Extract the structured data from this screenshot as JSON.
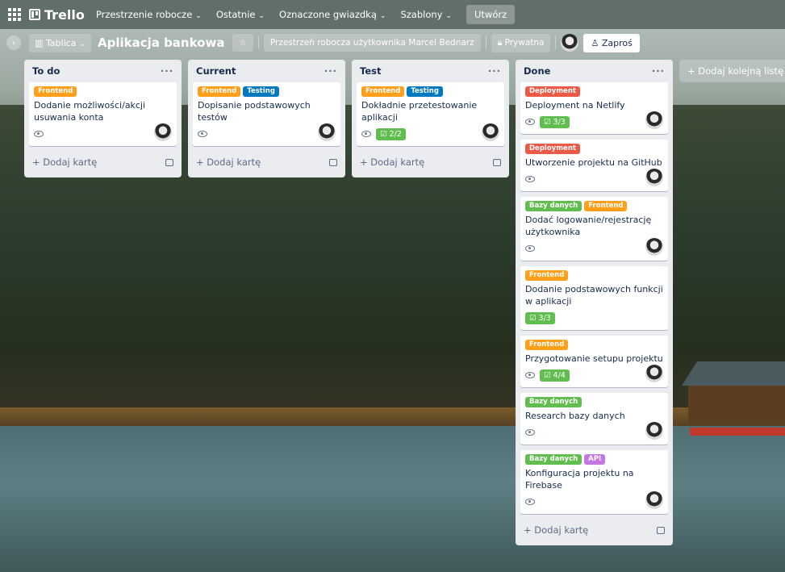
{
  "topbar": {
    "logo": "Trello",
    "nav": [
      "Przestrzenie robocze",
      "Ostatnie",
      "Oznaczone gwiazdką",
      "Szablony"
    ],
    "create": "Utwórz"
  },
  "board": {
    "view": "Tablica",
    "title": "Aplikacja bankowa",
    "star": "☆",
    "workspace": "Przestrzeń robocza użytkownika Marcel Bednarz",
    "visibility": "Prywatna",
    "invite": "Zaproś",
    "add_list": "+ Dodaj kolejną listę"
  },
  "lists": [
    {
      "title": "To do",
      "add_card": "+ Dodaj kartę",
      "cards": [
        {
          "labels": [
            {
              "text": "Frontend",
              "color": "orange"
            }
          ],
          "title": "Dodanie możliwości/akcji usuwania konta",
          "watch": true,
          "checklist": "",
          "avatar": true
        }
      ]
    },
    {
      "title": "Current",
      "add_card": "+ Dodaj kartę",
      "cards": [
        {
          "labels": [
            {
              "text": "Frontend",
              "color": "orange"
            },
            {
              "text": "Testing",
              "color": "blue"
            }
          ],
          "title": "Dopisanie podstawowych testów",
          "watch": true,
          "checklist": "",
          "avatar": true
        }
      ]
    },
    {
      "title": "Test",
      "add_card": "+ Dodaj kartę",
      "cards": [
        {
          "labels": [
            {
              "text": "Frontend",
              "color": "orange"
            },
            {
              "text": "Testing",
              "color": "blue"
            }
          ],
          "title": "Dokładnie przetestowanie aplikacji",
          "watch": true,
          "checklist": "2/2",
          "avatar": true
        }
      ]
    },
    {
      "title": "Done",
      "add_card": "+ Dodaj kartę",
      "cards": [
        {
          "labels": [
            {
              "text": "Deployment",
              "color": "red"
            }
          ],
          "title": "Deployment na Netlify",
          "watch": true,
          "checklist": "3/3",
          "avatar": true
        },
        {
          "labels": [
            {
              "text": "Deployment",
              "color": "red"
            }
          ],
          "title": "Utworzenie projektu na GitHub",
          "watch": true,
          "checklist": "",
          "avatar": true
        },
        {
          "labels": [
            {
              "text": "Bazy danych",
              "color": "green"
            },
            {
              "text": "Frontend",
              "color": "orange"
            }
          ],
          "title": "Dodać logowanie/rejestrację użytkownika",
          "watch": true,
          "checklist": "",
          "avatar": true
        },
        {
          "labels": [
            {
              "text": "Frontend",
              "color": "orange"
            }
          ],
          "title": "Dodanie podstawowych funkcji w aplikacji",
          "watch": false,
          "checklist": "3/3",
          "avatar": false
        },
        {
          "labels": [
            {
              "text": "Frontend",
              "color": "orange"
            }
          ],
          "title": "Przygotowanie setupu projektu",
          "watch": true,
          "checklist": "4/4",
          "avatar": true
        },
        {
          "labels": [
            {
              "text": "Bazy danych",
              "color": "green"
            }
          ],
          "title": "Research bazy danych",
          "watch": true,
          "checklist": "",
          "avatar": true
        },
        {
          "labels": [
            {
              "text": "Bazy danych",
              "color": "green"
            },
            {
              "text": "API",
              "color": "purple"
            }
          ],
          "title": "Konfiguracja projektu na Firebase",
          "watch": true,
          "checklist": "",
          "avatar": true
        }
      ]
    }
  ]
}
